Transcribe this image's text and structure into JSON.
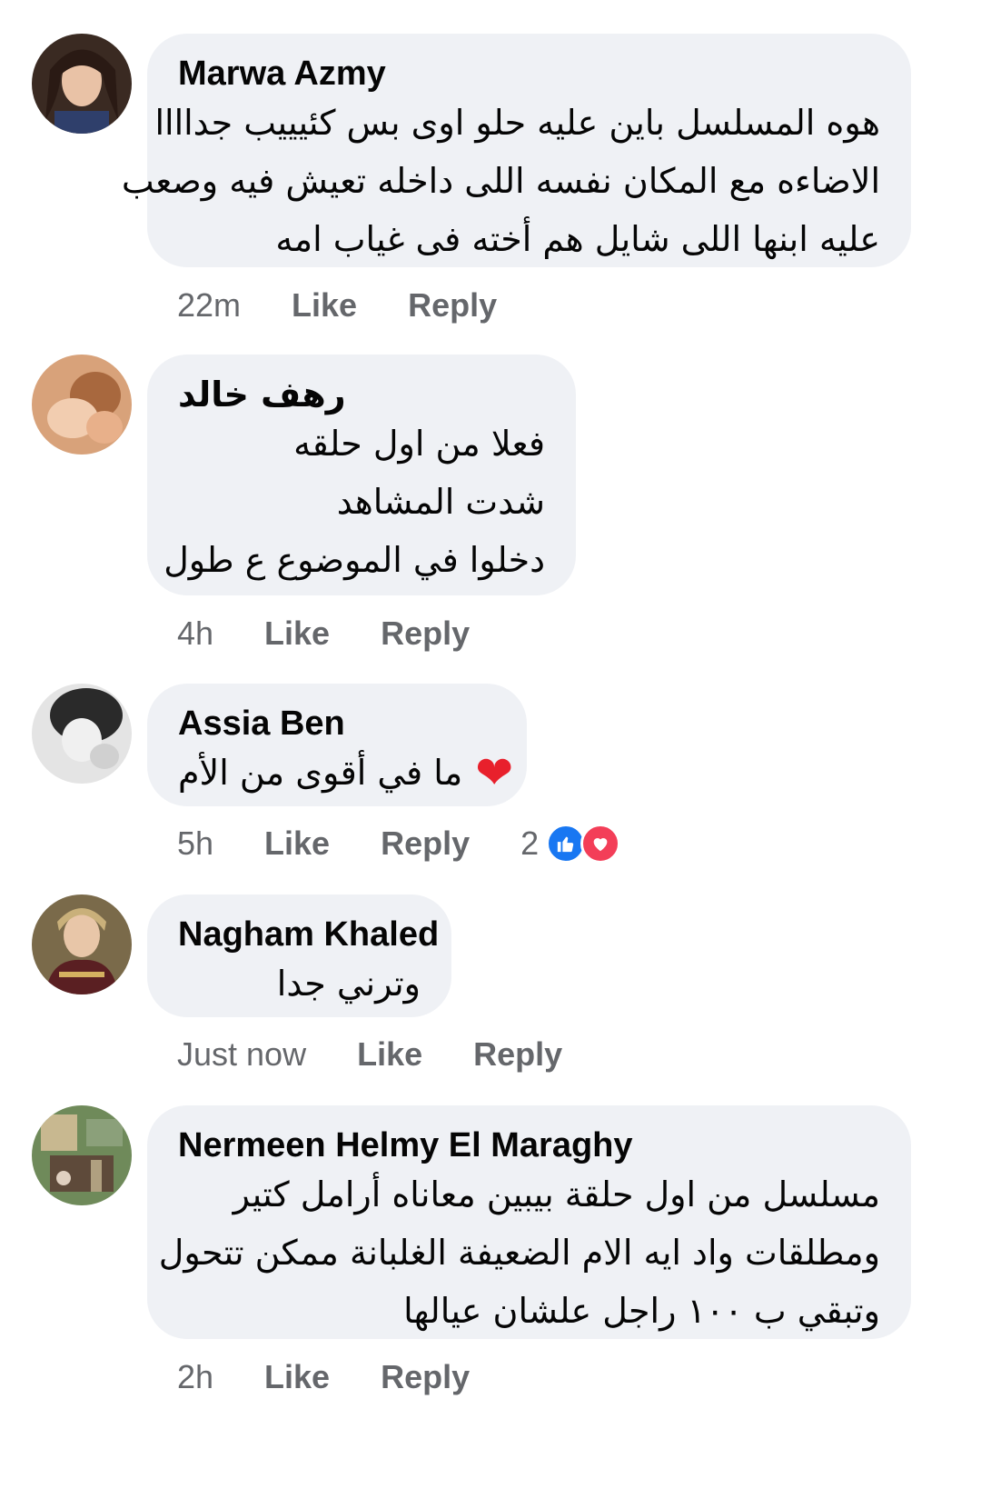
{
  "comments": [
    {
      "author": "Marwa Azmy",
      "lines": [
        "هوه المسلسل باين عليه حلو اوى بس كئيييب جداااا",
        "الاضاءه مع المكان نفسه اللى داخله تعيش فيه وصعب",
        "عليه ابنها اللى شايل هم أخته فى غياب امه"
      ],
      "time": "22m",
      "like": "Like",
      "reply": "Reply"
    },
    {
      "author": "رهف خالد",
      "lines": [
        "فعلا من اول حلقه",
        "شدت المشاهد",
        "دخلوا في الموضوع ع طول"
      ],
      "time": "4h",
      "like": "Like",
      "reply": "Reply"
    },
    {
      "author": "Assia Ben",
      "lines": [
        "ما في أقوى من الأم"
      ],
      "emoji": "❤",
      "time": "5h",
      "like": "Like",
      "reply": "Reply",
      "reaction_count": "2",
      "reaction_icons": [
        "like-reaction-icon",
        "love-reaction-icon"
      ]
    },
    {
      "author": "Nagham Khaled",
      "lines": [
        "وترني جدا"
      ],
      "time": "Just now",
      "like": "Like",
      "reply": "Reply"
    },
    {
      "author": "Nermeen Helmy El Maraghy",
      "lines": [
        "مسلسل من اول حلقة بيبين معاناه  أرامل كتير",
        "ومطلقات واد ايه الام الضعيفة الغلبانة ممكن تتحول",
        "وتبقي ب ١٠٠ راجل علشان عيالها"
      ],
      "time": "2h",
      "like": "Like",
      "reply": "Reply"
    }
  ],
  "colors": {
    "bubble": "#eff1f5",
    "meta": "#65676b",
    "like_blue": "#1877f2",
    "love_red": "#f33e58"
  }
}
